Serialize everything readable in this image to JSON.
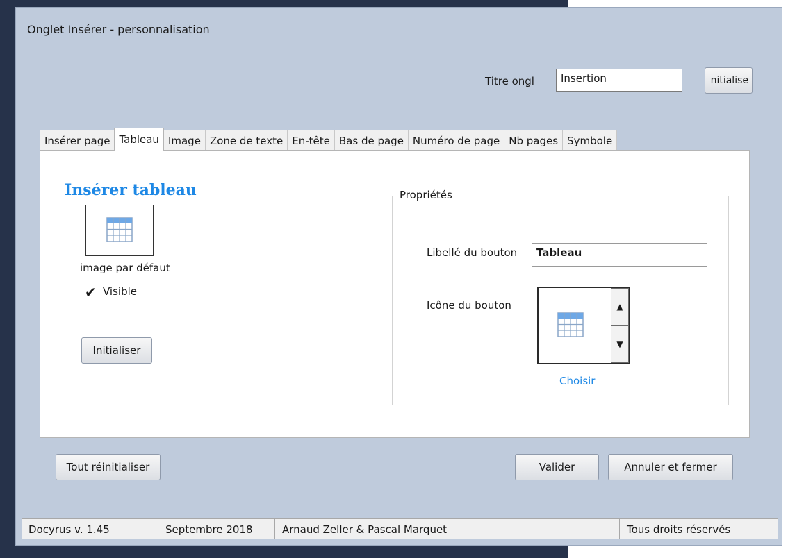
{
  "window": {
    "title": "Onglet Insérer - personnalisation"
  },
  "header": {
    "tab_title_label": "Titre ongl",
    "tab_title_value": "Insertion",
    "reset_button_label": "nitialise"
  },
  "tabs": [
    {
      "label": "Insérer page"
    },
    {
      "label": "Tableau",
      "active": true
    },
    {
      "label": "Image"
    },
    {
      "label": "Zone de texte"
    },
    {
      "label": "En-tête"
    },
    {
      "label": "Bas de page"
    },
    {
      "label": "Numéro de page"
    },
    {
      "label": "Nb pages"
    },
    {
      "label": "Symbole"
    }
  ],
  "panel": {
    "title": "Insérer tableau",
    "default_image_caption": "image par défaut",
    "visible_label": "Visible",
    "visible_checked": true,
    "init_button_label": "Initialiser",
    "properties": {
      "legend": "Propriétés",
      "button_label_label": "Libellé du bouton",
      "button_label_value": "Tableau",
      "button_icon_label": "Icône du bouton",
      "choose_link": "Choisir",
      "icon": "table-icon"
    }
  },
  "footer_buttons": {
    "reset_all": "Tout réinitialiser",
    "validate": "Valider",
    "cancel_close": "Annuler et fermer"
  },
  "status_bar": {
    "version": "Docyrus v. 1.45",
    "date": "Septembre 2018",
    "authors": "Arnaud Zeller & Pascal Marquet",
    "rights": "Tous droits réservés"
  },
  "colors": {
    "accent": "#1e88e5",
    "window_bg": "#bfcbdc"
  }
}
